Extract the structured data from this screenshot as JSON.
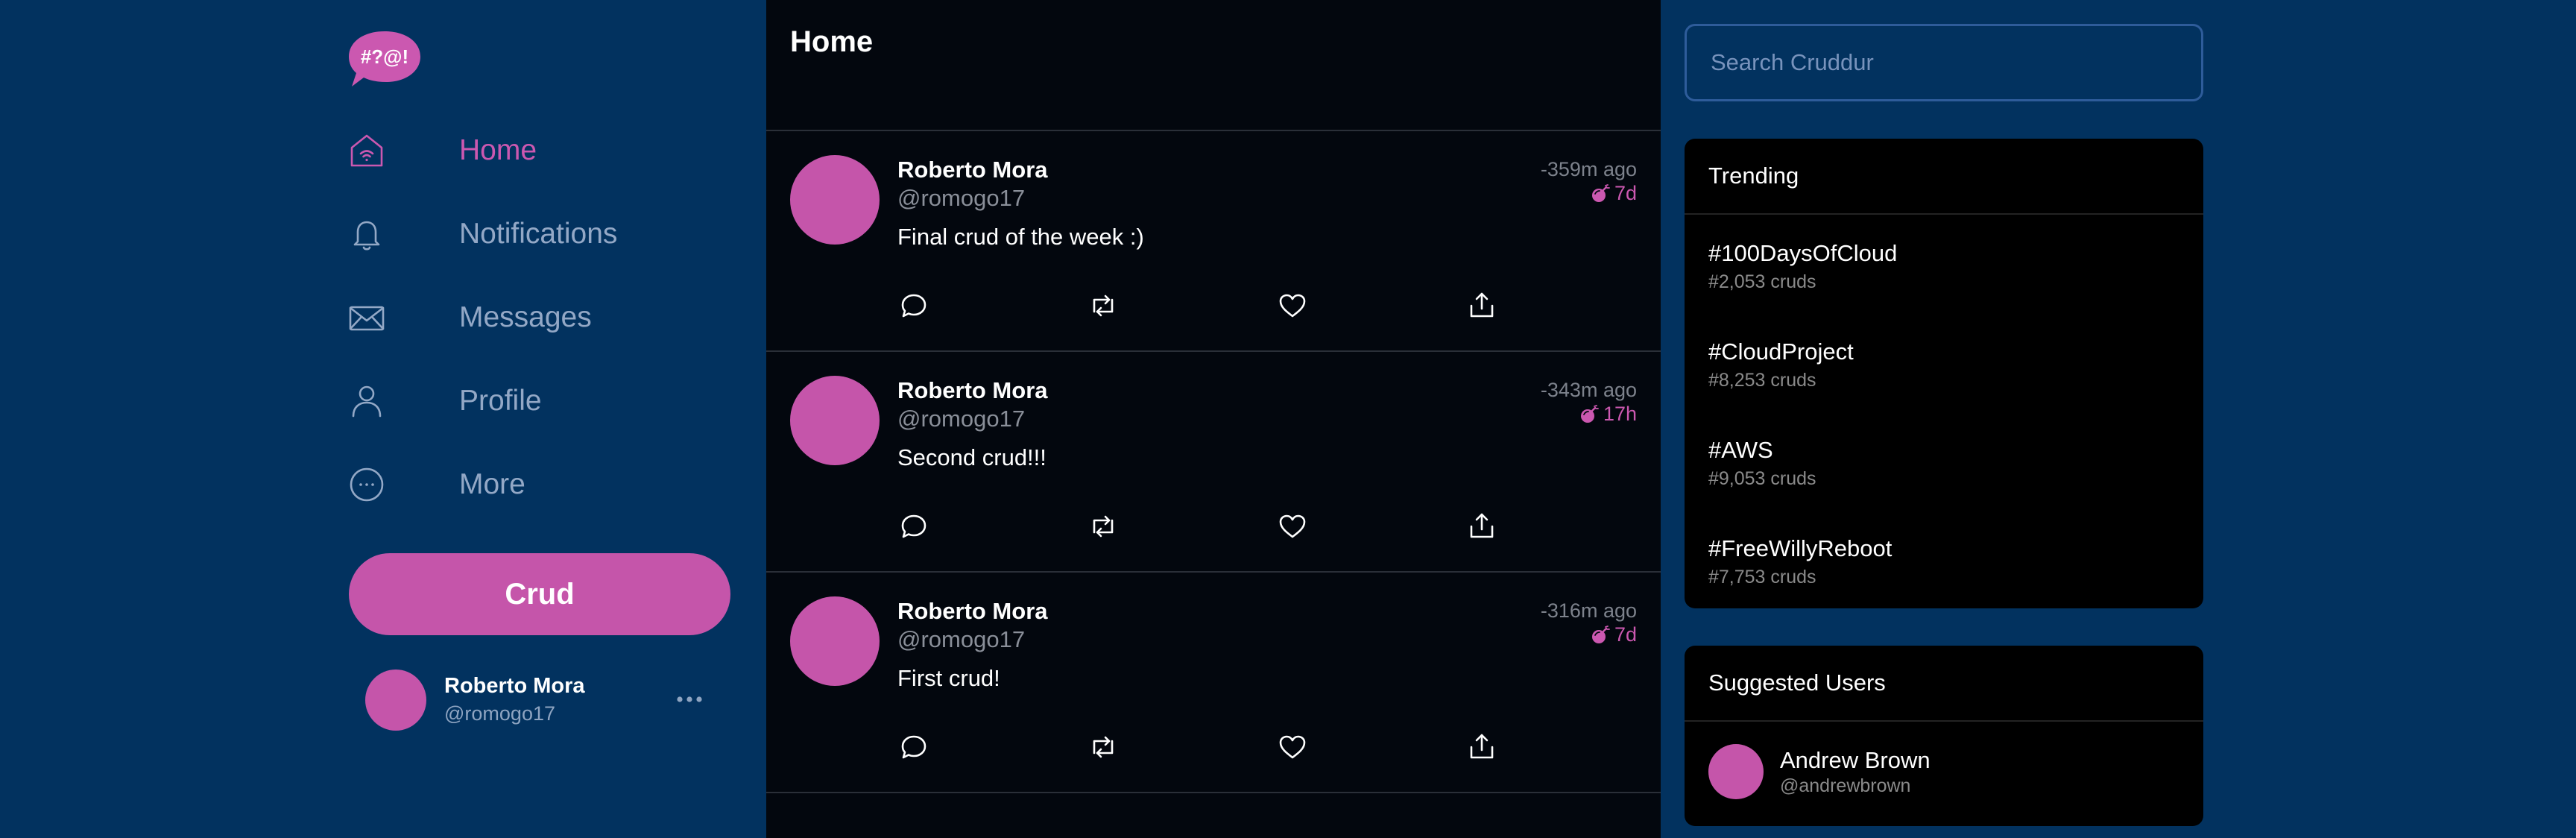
{
  "app": {
    "logo_text": "#?@!",
    "accent_color": "#c555aa",
    "background_color": "#02325f",
    "feed_background": "#03070e"
  },
  "nav": {
    "items": [
      {
        "label": "Home",
        "icon": "home-icon",
        "active": true
      },
      {
        "label": "Notifications",
        "icon": "bell-icon",
        "active": false
      },
      {
        "label": "Messages",
        "icon": "envelope-icon",
        "active": false
      },
      {
        "label": "Profile",
        "icon": "person-icon",
        "active": false
      },
      {
        "label": "More",
        "icon": "more-circle-icon",
        "active": false
      }
    ],
    "crud_button": "Crud"
  },
  "current_user": {
    "name": "Roberto Mora",
    "handle": "@romogo17"
  },
  "feed": {
    "title": "Home",
    "posts": [
      {
        "name": "Roberto Mora",
        "handle": "@romogo17",
        "text": "Final crud of the week :)",
        "time": "-359m ago",
        "expires": "7d"
      },
      {
        "name": "Roberto Mora",
        "handle": "@romogo17",
        "text": "Second crud!!!",
        "time": "-343m ago",
        "expires": "17h"
      },
      {
        "name": "Roberto Mora",
        "handle": "@romogo17",
        "text": "First crud!",
        "time": "-316m ago",
        "expires": "7d"
      }
    ]
  },
  "search": {
    "placeholder": "Search Cruddur"
  },
  "trending": {
    "title": "Trending",
    "items": [
      {
        "tag": "#100DaysOfCloud",
        "count": "#2,053 cruds"
      },
      {
        "tag": "#CloudProject",
        "count": "#8,253 cruds"
      },
      {
        "tag": "#AWS",
        "count": "#9,053 cruds"
      },
      {
        "tag": "#FreeWillyReboot",
        "count": "#7,753 cruds"
      }
    ]
  },
  "suggested": {
    "title": "Suggested Users",
    "users": [
      {
        "name": "Andrew Brown",
        "handle": "@andrewbrown"
      }
    ]
  }
}
